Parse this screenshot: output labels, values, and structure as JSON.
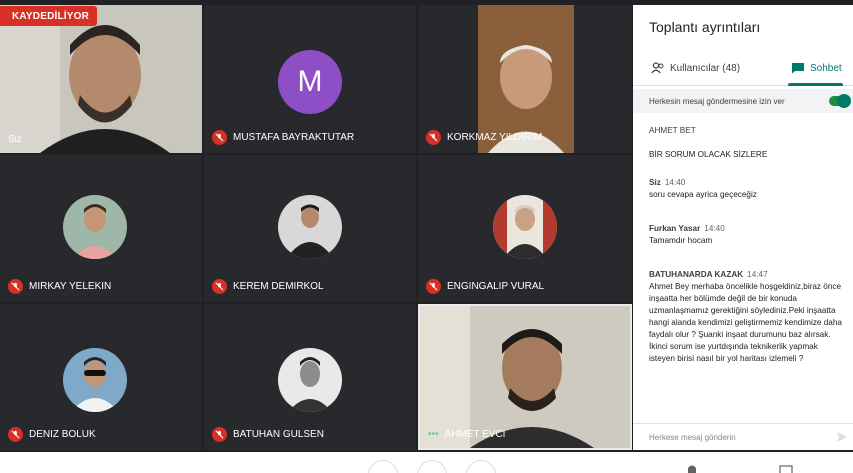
{
  "recording_badge": "KAYDEDİLİYOR",
  "participants": [
    {
      "name": "Siz"
    },
    {
      "name": "MUSTAFA BAYRAKTUTAR",
      "initial": "M"
    },
    {
      "name": "KORKMAZ YILDIRIM"
    },
    {
      "name": "MIRKAY YELEKIN"
    },
    {
      "name": "KEREM DEMIRKOL"
    },
    {
      "name": "ENGINGALIP VURAL"
    },
    {
      "name": "DENIZ BOLUK"
    },
    {
      "name": "BATUHAN GULSEN"
    },
    {
      "name": "AHMET EVCI",
      "speaking_indicator": "•••"
    }
  ],
  "panel": {
    "title": "Toplantı ayrıntıları",
    "tab_users": "Kullanıcılar (48)",
    "tab_chat": "Sohbet",
    "allow_all": "Herkesin mesaj göndermesine izin ver",
    "messages": [
      {
        "sender": "AHMET BET",
        "time": "",
        "text": "BİR SORUM OLACAK SİZLERE"
      },
      {
        "sender": "Siz",
        "time": "14:40",
        "text": "soru cevapa ayrica geçeceğiz"
      },
      {
        "sender": "Furkan Yasar",
        "time": "14:40",
        "text": "Tamamdır hocam"
      },
      {
        "sender": "BATUHANARDA KAZAK",
        "time": "14:47",
        "text": "Ahmet Bey merhaba öncelikle hoşgeldiniz,biraz önce inşaatta her bölümde değil de bir konuda uzmanlaşmamız gerektiğini söylediniz.Peki inşaatta hangi alanda kendimizi geliştirmemiz kendimize daha faydalı olur ? Şuanki inşaat durumunu baz alırsak. İkinci sorum ise yurtdışında teknikerlik yapmak isteyen birisi nasıl bir yol haritası izlemeli ?"
      }
    ],
    "input_placeholder": "Herkese mesaj gönderin"
  },
  "colors": {
    "accent": "#00796b",
    "recording": "#d93025",
    "tile_bg": "#3c4043"
  }
}
